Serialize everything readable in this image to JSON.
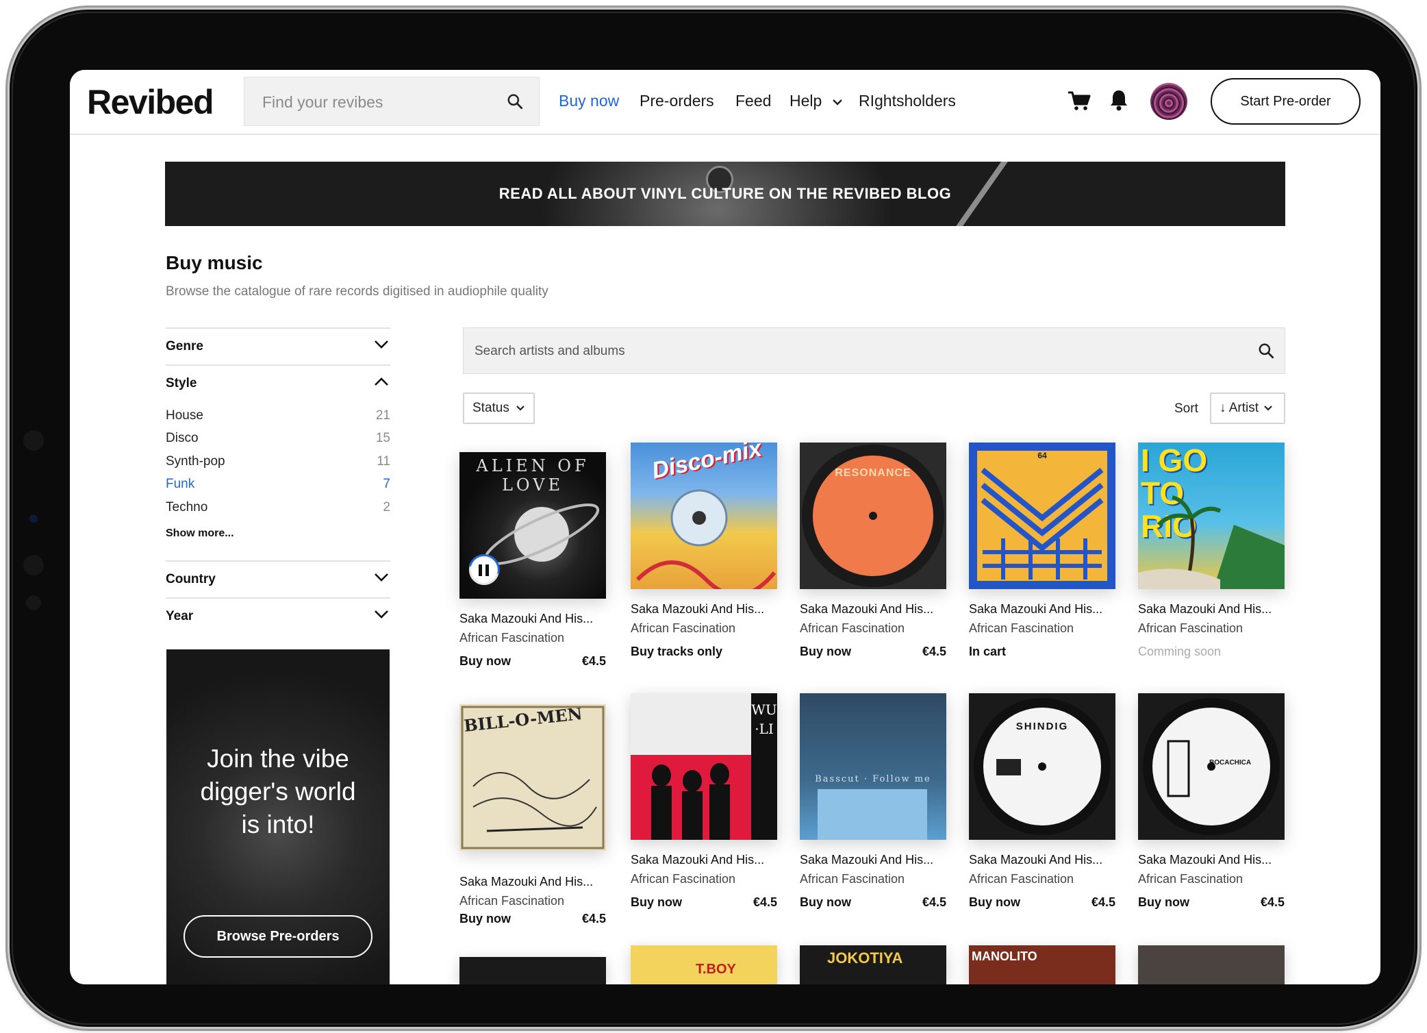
{
  "header": {
    "logo": "Revibed",
    "search_placeholder": "Find your revibes",
    "nav": [
      "Buy now",
      "Pre-orders",
      "Feed",
      "Help",
      "RIghtsholders"
    ],
    "cta": "Start Pre-order"
  },
  "banner": {
    "text": "READ ALL ABOUT VINYL CULTURE ON THE REVIBED BLOG"
  },
  "page": {
    "title": "Buy music",
    "subtitle": "Browse the catalogue of rare records digitised in audiophile quality"
  },
  "filters": {
    "genre": "Genre",
    "style": "Style",
    "style_items": [
      {
        "label": "House",
        "count": "21"
      },
      {
        "label": "Disco",
        "count": "15"
      },
      {
        "label": "Synth-pop",
        "count": "11"
      },
      {
        "label": "Funk",
        "count": "7"
      },
      {
        "label": "Techno",
        "count": "2"
      }
    ],
    "show_more": "Show more...",
    "country": "Country",
    "year": "Year"
  },
  "promo": {
    "line1": "Join the vibe",
    "line2": "digger's world",
    "line3": "is into!",
    "button": "Browse Pre-orders"
  },
  "catalog": {
    "search_placeholder": "Search artists and albums",
    "status_label": "Status",
    "sort_label": "Sort",
    "sort_value": "↓ Artist"
  },
  "cards": [
    {
      "artist": "Saka Mazouki And His...",
      "album": "African Fascination",
      "status": "Buy now",
      "price": "€4.5",
      "cover_text": "ALIEN OF LOVE"
    },
    {
      "artist": "Saka Mazouki And His...",
      "album": "African Fascination",
      "status": "Buy tracks only",
      "price": "",
      "cover_text": "Disco-mix"
    },
    {
      "artist": "Saka Mazouki And His...",
      "album": "African Fascination",
      "status": "Buy now",
      "price": "€4.5",
      "cover_text": "RESONANCE"
    },
    {
      "artist": "Saka Mazouki And His...",
      "album": "African Fascination",
      "status": "In cart",
      "price": "",
      "cover_text": "64"
    },
    {
      "artist": "Saka Mazouki And His...",
      "album": "African Fascination",
      "status": "Comming soon",
      "price": "",
      "cover_text": "I GO TO RIO"
    },
    {
      "artist": "Saka Mazouki And His...",
      "album": "African Fascination",
      "status": "Buy now",
      "price": "€4.5",
      "cover_text": "BILL-O-MEN"
    },
    {
      "artist": "Saka Mazouki And His...",
      "album": "African Fascination",
      "status": "Buy now",
      "price": "€4.5",
      "cover_text": "WU·LI"
    },
    {
      "artist": "Saka Mazouki And His...",
      "album": "African Fascination",
      "status": "Buy now",
      "price": "€4.5",
      "cover_text": "Basscut · Follow me"
    },
    {
      "artist": "Saka Mazouki And His...",
      "album": "African Fascination",
      "status": "Buy now",
      "price": "€4.5",
      "cover_text": "SHINDIG"
    },
    {
      "artist": "Saka Mazouki And His...",
      "album": "African Fascination",
      "status": "Buy now",
      "price": "€4.5",
      "cover_text": "BOCACHICA"
    }
  ],
  "peek_covers": [
    "",
    "T.BOY",
    "JOKOTIYA",
    "MANOLITO",
    ""
  ],
  "colors": {
    "accent": "#1f66d6",
    "text": "#111111",
    "muted": "#8a8a8a"
  }
}
